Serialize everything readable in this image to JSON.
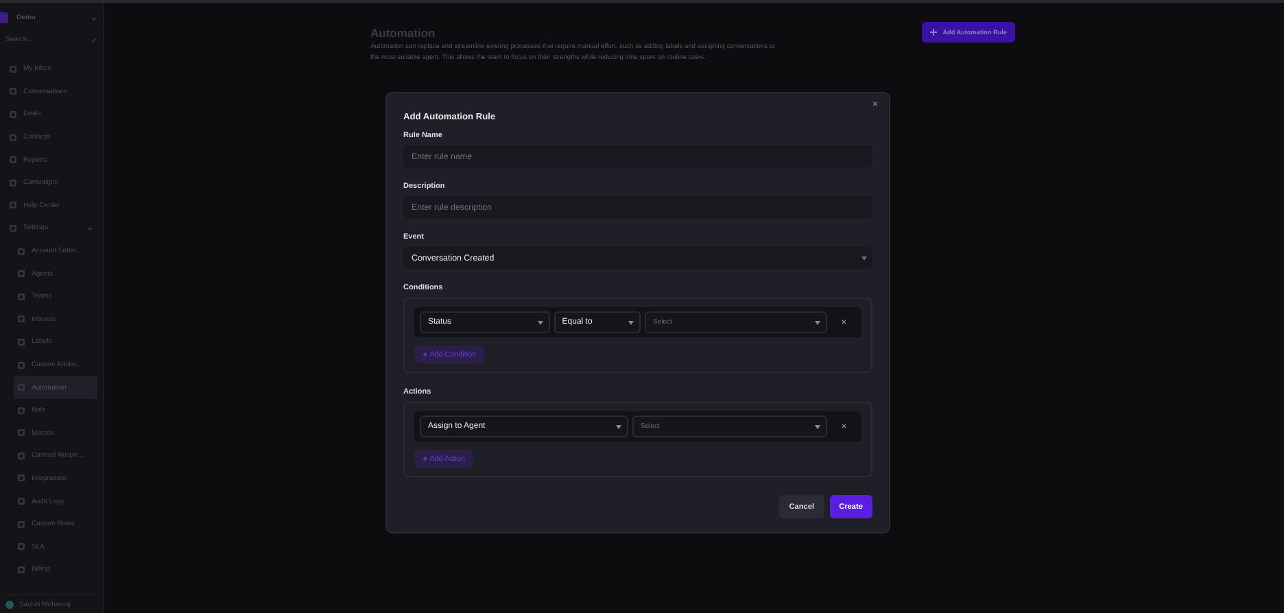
{
  "sidebar": {
    "workspace": "Demo",
    "search": {
      "placeholder": "Search..."
    },
    "items": [
      {
        "label": "My Inbox",
        "selected": false
      },
      {
        "label": "Conversations",
        "selected": false
      },
      {
        "label": "Deals",
        "selected": false
      },
      {
        "label": "Contacts",
        "selected": false
      },
      {
        "label": "Reports",
        "selected": false
      },
      {
        "label": "Campaigns",
        "selected": false
      },
      {
        "label": "Help Center",
        "selected": false
      },
      {
        "label": "Settings",
        "selected": false,
        "expanded": true,
        "children": [
          {
            "label": "Account Settin…",
            "selected": false
          },
          {
            "label": "Agents",
            "selected": false
          },
          {
            "label": "Teams",
            "selected": false
          },
          {
            "label": "Inboxes",
            "selected": false
          },
          {
            "label": "Labels",
            "selected": false
          },
          {
            "label": "Custom Attribu…",
            "selected": false
          },
          {
            "label": "Automation",
            "selected": true
          },
          {
            "label": "Bots",
            "selected": false
          },
          {
            "label": "Macros",
            "selected": false
          },
          {
            "label": "Canned Respo…",
            "selected": false
          },
          {
            "label": "Integrations",
            "selected": false
          },
          {
            "label": "Audit Logs",
            "selected": false
          },
          {
            "label": "Custom Roles",
            "selected": false
          },
          {
            "label": "SLA",
            "selected": false
          },
          {
            "label": "Billing",
            "selected": false
          }
        ]
      }
    ],
    "user": "Sachin Mohanraj"
  },
  "page": {
    "title": "Automation",
    "description": "Automation can replace and streamline existing processes that require manual effort, such as adding labels and assigning conversations to the most suitable agent. This allows the team to focus on their strengths while reducing time spent on routine tasks.",
    "add_button": "Add Automation Rule"
  },
  "dialog": {
    "title": "Add Automation Rule",
    "close": "×",
    "rule_name": {
      "label": "Rule Name",
      "placeholder": "Enter rule name"
    },
    "description": {
      "label": "Description",
      "placeholder": "Enter rule description"
    },
    "event": {
      "label": "Event",
      "value": "Conversation Created"
    },
    "conditions": {
      "label": "Conditions",
      "rows": [
        {
          "attribute": "Status",
          "operator": "Equal to",
          "value_placeholder": "Select",
          "remove": "×"
        }
      ],
      "add_button": "Add Condition"
    },
    "actions": {
      "label": "Actions",
      "rows": [
        {
          "action": "Assign to Agent",
          "value_placeholder": "Select",
          "remove": "×"
        }
      ],
      "add_button": "Add Action"
    },
    "buttons": {
      "cancel": "Cancel",
      "create": "Create"
    }
  }
}
